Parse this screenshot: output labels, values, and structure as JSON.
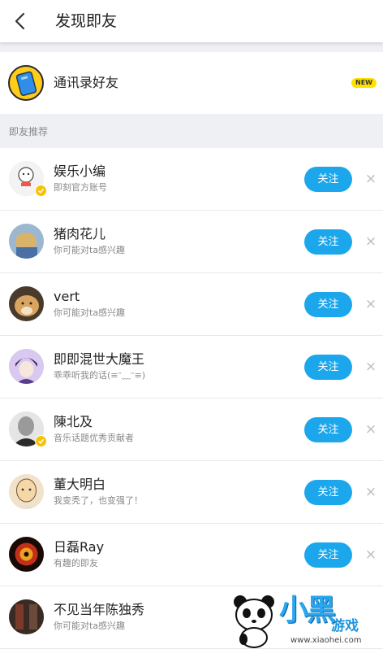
{
  "header": {
    "title": "发现即友",
    "back_icon": "chevron-left-icon"
  },
  "contacts": {
    "label": "通讯录好友",
    "badge": "NEW",
    "icon": "address-book-icon"
  },
  "section": {
    "title": "即友推荐"
  },
  "follow_label": "关注",
  "dismiss_glyph": "×",
  "users": [
    {
      "name": "娱乐小编",
      "sub": "即刻官方账号",
      "verified": true
    },
    {
      "name": "猪肉花儿",
      "sub": "你可能对ta感兴趣",
      "verified": false
    },
    {
      "name": "vert",
      "sub": "你可能对ta感兴趣",
      "verified": false
    },
    {
      "name": "即即混世大魔王",
      "sub": "乖乖听我的话(≡ᵔ﹏ᵔ≡)",
      "verified": false
    },
    {
      "name": "陳北及",
      "sub": "音乐话题优秀贡献者",
      "verified": true
    },
    {
      "name": "董大明白",
      "sub": "我变秃了，也变强了！",
      "verified": false
    },
    {
      "name": "日磊Ray",
      "sub": "有趣的即友",
      "verified": false
    },
    {
      "name": "不见当年陈独秀",
      "sub": "你可能对ta感兴趣",
      "verified": false
    }
  ],
  "colors": {
    "accent": "#1ca7ec",
    "verified_badge": "#f8c200",
    "new_badge": "#ffe100"
  },
  "watermark": {
    "logo_text": "小黑",
    "sub_text": "游戏",
    "url": "www.xiaohei.com"
  }
}
